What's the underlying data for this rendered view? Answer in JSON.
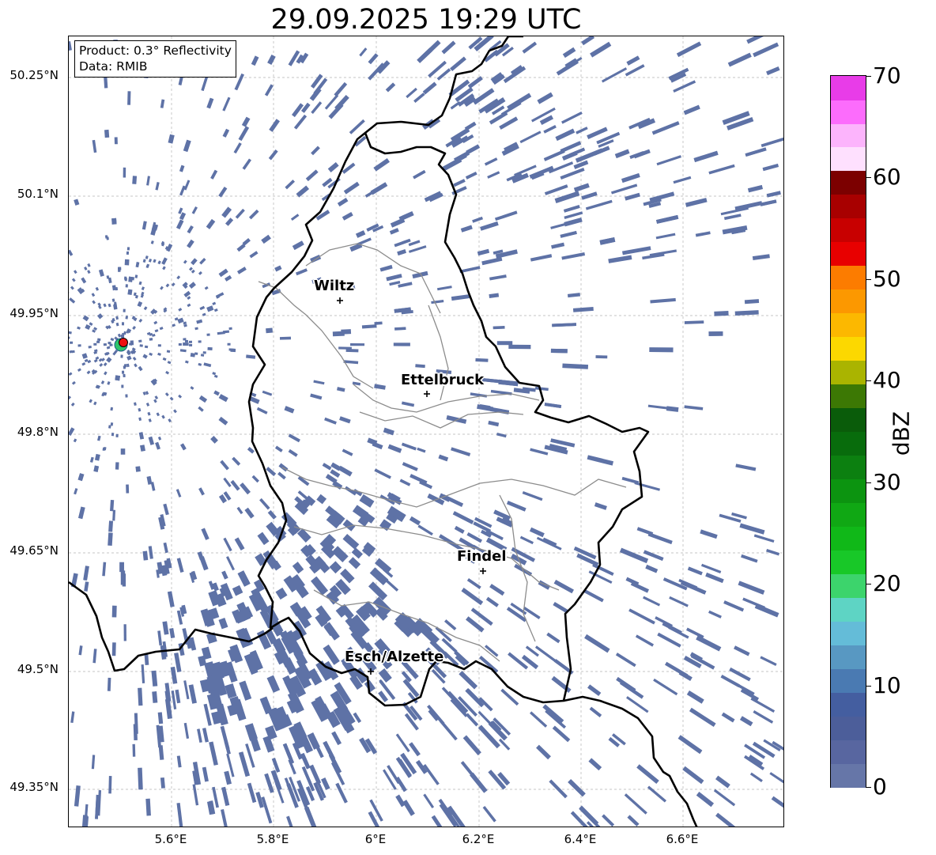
{
  "title": "29.09.2025 19:29 UTC",
  "info_box": {
    "product": "Product: 0.3° Reflectivity",
    "data": "Data: RMIB"
  },
  "lat_labels": [
    "50.25°N",
    "50.1°N",
    "49.95°N",
    "49.8°N",
    "49.65°N",
    "49.5°N",
    "49.35°N"
  ],
  "lon_labels": [
    "5.6°E",
    "5.8°E",
    "6°E",
    "6.2°E",
    "6.4°E",
    "6.6°E"
  ],
  "cities": [
    "Wiltz",
    "Ettelbruck",
    "Findel",
    "Esch/Alzette"
  ],
  "colorbar": {
    "unit": "dBZ",
    "tick_labels": [
      "0",
      "10",
      "20",
      "30",
      "40",
      "50",
      "60",
      "70"
    ],
    "range": [
      0,
      70
    ],
    "step": 2.5,
    "colors": [
      "#6676a8",
      "#5866a0",
      "#4c5e9a",
      "#445ea0",
      "#4a7ab2",
      "#5898c2",
      "#64bcd8",
      "#5ed4c4",
      "#3cd46c",
      "#18c828",
      "#10b818",
      "#10a814",
      "#0c9410",
      "#0c8010",
      "#086c0c",
      "#0a5c0a",
      "#3c7804",
      "#aab400",
      "#fcd800",
      "#fcb800",
      "#fc9800",
      "#fc7c00",
      "#e80000",
      "#c80000",
      "#a80000",
      "#7c0000",
      "#fee0fe",
      "#fcb4fc",
      "#fc6cfc",
      "#e83ce8"
    ]
  },
  "map_colors": {
    "echo": "#5e72a6",
    "border": "#000000",
    "canton": "#8c8c8c",
    "radar_site": "#ee1111",
    "radar_ring": "#2ec46a"
  }
}
